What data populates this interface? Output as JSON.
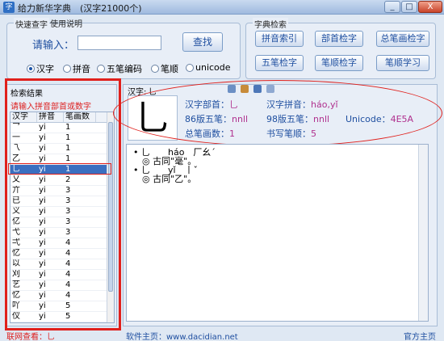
{
  "window": {
    "title": "给力新华字典　(汉字21000个)",
    "icon": "dictionary-icon",
    "min_label": "_",
    "max_label": "□",
    "close_label": "X"
  },
  "quick": {
    "group_title": "快速查字",
    "help_tab": "使用说明",
    "input_label": "请输入：",
    "input_value": "",
    "search_button": "查找",
    "modes": [
      "汉字",
      "拼音",
      "五笔编码",
      "笔顺",
      "unicode"
    ],
    "selected_mode": "汉字"
  },
  "dict": {
    "group_title": "字典检索",
    "buttons": [
      "拼音索引",
      "部首检字",
      "总笔画检字",
      "五笔检字",
      "笔顺检字",
      "笔顺学习"
    ]
  },
  "results": {
    "panel_title": "检索结果",
    "hint": "请输入拼音部首或数字",
    "headers": [
      "汉字",
      "拼音",
      "笔画数"
    ],
    "rows": [
      [
        "乛",
        "yi",
        "1"
      ],
      [
        "一",
        "yi",
        "1"
      ],
      [
        "乁",
        "yi",
        "1"
      ],
      [
        "乙",
        "yi",
        "1"
      ],
      [
        "乚",
        "yi",
        "1"
      ],
      [
        "乂",
        "yi",
        "2"
      ],
      [
        "亣",
        "yi",
        "3"
      ],
      [
        "已",
        "yi",
        "3"
      ],
      [
        "义",
        "yi",
        "3"
      ],
      [
        "亿",
        "yi",
        "3"
      ],
      [
        "弋",
        "yi",
        "3"
      ],
      [
        "弌",
        "yi",
        "4"
      ],
      [
        "忆",
        "yi",
        "4"
      ],
      [
        "以",
        "yi",
        "4"
      ],
      [
        "刈",
        "yi",
        "4"
      ],
      [
        "艺",
        "yi",
        "4"
      ],
      [
        "忆",
        "yi",
        "4"
      ],
      [
        "吖",
        "yi",
        "5"
      ],
      [
        "仪",
        "yi",
        "5"
      ]
    ],
    "selected_index": 4
  },
  "detail": {
    "hanzi_label": "汉字:",
    "hanzi": "乚",
    "big_char": "乚",
    "radical_label": "汉字部首：",
    "radical_value": "乚",
    "pinyin_label": "汉字拼音：",
    "pinyin_value": "háo,yǐ",
    "wubi86_label": "86版五笔：",
    "wubi86_value": "nnll",
    "wubi98_label": "98版五笔：",
    "wubi98_value": "nnll",
    "unicode_label": "Unicode：",
    "unicode_value": "4E5A",
    "strokes_label": "总笔画数：",
    "strokes_value": "1",
    "stroke_order_label": "书写笔顺：",
    "stroke_order_value": "5"
  },
  "tools": [
    "sound-icon",
    "chart-icon",
    "copy-icon",
    "paste-icon"
  ],
  "explanation": [
    "• 乚　　háo　厂幺ˊ",
    "　◎ 古同\"毫\"。",
    "• 乚　　yǐ　丨ˇ",
    "　◎ 古同\"乙\"。"
  ],
  "footer": {
    "online_label": "联网查看：乚",
    "site_label": "软件主页：www.dacidian.net",
    "official_label": "官方主页"
  },
  "colors": {
    "accent": "#1f4fa0",
    "value": "#b0308e",
    "highlight": "#e0201c",
    "selected_row": "#3a6fc0"
  }
}
